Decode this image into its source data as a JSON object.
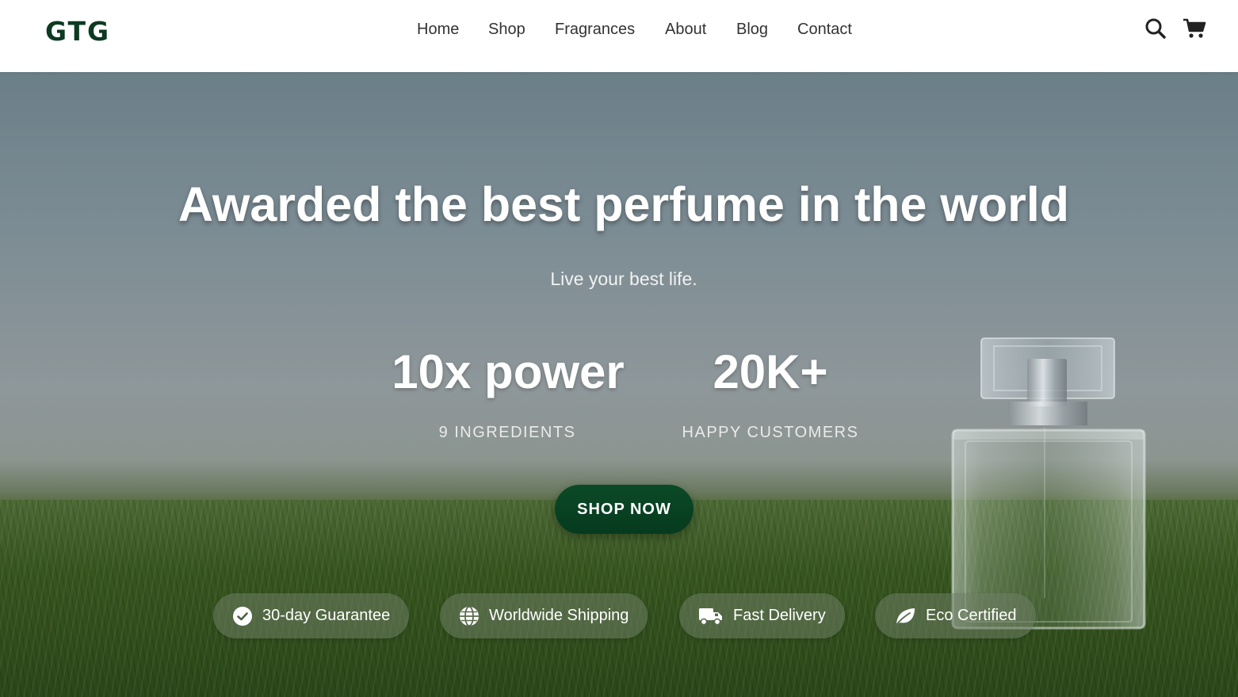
{
  "brand": {
    "logo": "GTG"
  },
  "nav": {
    "items": [
      {
        "label": "Home"
      },
      {
        "label": "Shop"
      },
      {
        "label": "Fragrances"
      },
      {
        "label": "About"
      },
      {
        "label": "Blog"
      },
      {
        "label": "Contact"
      }
    ]
  },
  "header_icons": {
    "search": "search-icon",
    "cart": "cart-icon"
  },
  "hero": {
    "title": "Awarded the best perfume in the world",
    "subtitle": "Live your best life.",
    "stats": [
      {
        "value": "10x power",
        "label": "9 INGREDIENTS"
      },
      {
        "value": "20K+",
        "label": "HAPPY CUSTOMERS"
      }
    ],
    "cta": "SHOP NOW",
    "badges": [
      {
        "label": "30-day Guarantee",
        "icon": "check-circle-icon"
      },
      {
        "label": "Worldwide Shipping",
        "icon": "globe-icon"
      },
      {
        "label": "Fast Delivery",
        "icon": "truck-icon"
      },
      {
        "label": "Eco Certified",
        "icon": "leaf-icon"
      }
    ]
  },
  "colors": {
    "brand": "#0c3a22",
    "cta": "#063a1e",
    "white": "#ffffff"
  }
}
